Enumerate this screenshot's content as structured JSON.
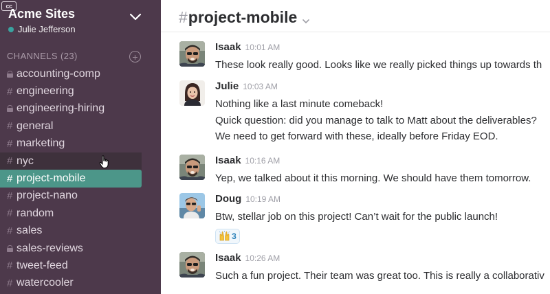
{
  "sidebar": {
    "badge": "cc",
    "team_name": "Acme Sites",
    "user_name": "Julie Jefferson",
    "presence_color": "#3aa3a0",
    "channels_label": "CHANNELS",
    "channels_count": "(23)",
    "channels": [
      {
        "name": "accounting-comp",
        "private": true,
        "state": "normal"
      },
      {
        "name": "engineering",
        "private": false,
        "state": "normal"
      },
      {
        "name": "engineering-hiring",
        "private": true,
        "state": "normal"
      },
      {
        "name": "general",
        "private": false,
        "state": "normal"
      },
      {
        "name": "marketing",
        "private": false,
        "state": "normal"
      },
      {
        "name": "nyc",
        "private": false,
        "state": "hovered"
      },
      {
        "name": "project-mobile",
        "private": false,
        "state": "active"
      },
      {
        "name": "project-nano",
        "private": false,
        "state": "normal"
      },
      {
        "name": "random",
        "private": false,
        "state": "normal"
      },
      {
        "name": "sales",
        "private": false,
        "state": "normal"
      },
      {
        "name": "sales-reviews",
        "private": true,
        "state": "normal"
      },
      {
        "name": "tweet-feed",
        "private": false,
        "state": "normal"
      },
      {
        "name": "watercooler",
        "private": false,
        "state": "normal"
      }
    ]
  },
  "main": {
    "channel_hash": "#",
    "channel_name": "project-mobile",
    "messages": [
      {
        "author": "Isaak",
        "time": "10:01 AM",
        "avatar": "isaak-avatar",
        "lines": [
          "These look really good. Looks like we really picked things up towards th"
        ]
      },
      {
        "author": "Julie",
        "time": "10:03 AM",
        "avatar": "julie-avatar",
        "lines": [
          "Nothing like a last minute comeback!",
          "Quick question: did you manage to talk to Matt about the deliverables?",
          "We need to get forward with these, ideally before Friday EOD."
        ]
      },
      {
        "author": "Isaak",
        "time": "10:16 AM",
        "avatar": "isaak-avatar",
        "lines": [
          "Yep, we talked about it this morning. We should have them tomorrow."
        ]
      },
      {
        "author": "Doug",
        "time": "10:19 AM",
        "avatar": "doug-avatar",
        "lines": [
          "Btw, stellar job on this project! Can’t wait for the public launch!"
        ],
        "reaction": {
          "emoji": "raised-hands",
          "count": "3"
        }
      },
      {
        "author": "Isaak",
        "time": "10:26 AM",
        "avatar": "isaak-avatar",
        "lines": [
          "Such a fun project. Their team was great too. This is really a collaborativ"
        ]
      }
    ]
  },
  "colors": {
    "sidebar_bg": "#4d394b",
    "active_channel": "#4c9689",
    "hover_channel": "#3e313c"
  }
}
